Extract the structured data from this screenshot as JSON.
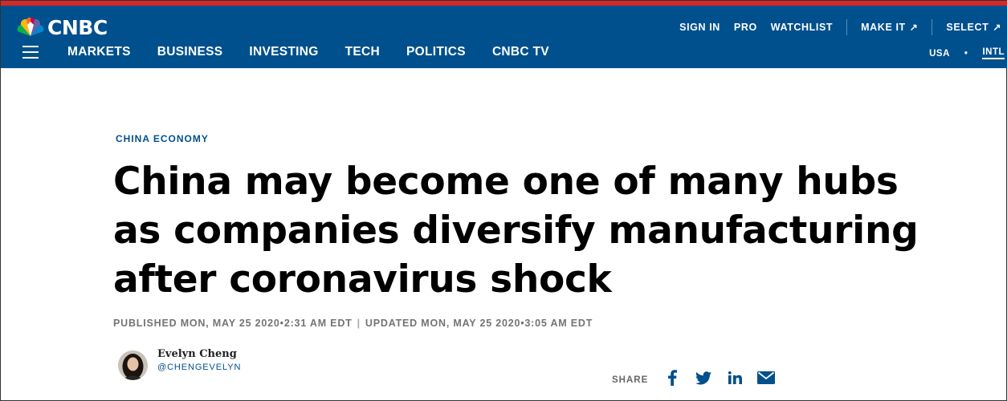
{
  "brand": {
    "name": "CNBC"
  },
  "colors": {
    "header_bg": "#00508d",
    "accent_red": "#d62828",
    "link_blue": "#00508d",
    "muted_text": "#747474"
  },
  "util_nav": [
    {
      "label": "SIGN IN"
    },
    {
      "label": "PRO"
    },
    {
      "label": "WATCHLIST"
    },
    {
      "label": "MAKE IT",
      "icon": "external-arrow-icon"
    },
    {
      "label": "SELECT",
      "icon": "external-arrow-icon"
    }
  ],
  "main_nav": [
    "MARKETS",
    "BUSINESS",
    "INVESTING",
    "TECH",
    "POLITICS",
    "CNBC TV"
  ],
  "region": {
    "usa": "USA",
    "dot": "•",
    "intl": "INTL"
  },
  "article": {
    "kicker": "CHINA ECONOMY",
    "headline_lines": [
      "China may become one of many hubs",
      "as companies diversify manufacturing",
      "after coronavirus shock"
    ],
    "published": "PUBLISHED MON, MAY 25 2020•2:31 AM EDT",
    "separator": "|",
    "updated": "UPDATED MON, MAY 25 2020•3:05 AM EDT"
  },
  "author": {
    "name": "Evelyn Cheng",
    "handle": "@CHENGEVELYN"
  },
  "share": {
    "label": "SHARE",
    "icons": [
      "facebook-icon",
      "twitter-icon",
      "linkedin-icon",
      "email-icon"
    ]
  }
}
